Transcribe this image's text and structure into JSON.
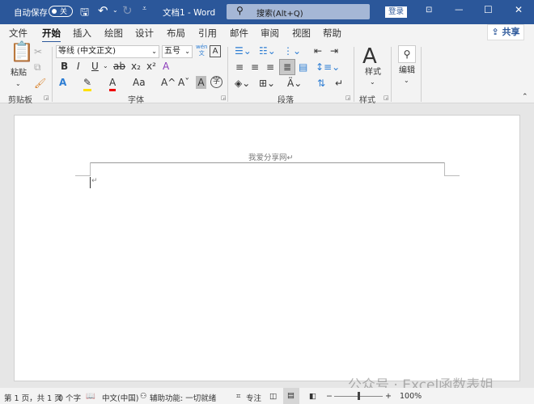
{
  "titlebar": {
    "autosave_label": "自动保存",
    "autosave_state": "关",
    "doc_title": "文档1 - Word",
    "search_placeholder": "搜索(Alt+Q)",
    "login": "登录",
    "bg_color": "#2b579a"
  },
  "tabs": [
    {
      "label": "文件"
    },
    {
      "label": "开始",
      "active": true
    },
    {
      "label": "插入"
    },
    {
      "label": "绘图"
    },
    {
      "label": "设计"
    },
    {
      "label": "布局"
    },
    {
      "label": "引用"
    },
    {
      "label": "邮件"
    },
    {
      "label": "审阅"
    },
    {
      "label": "视图"
    },
    {
      "label": "帮助"
    }
  ],
  "share_label": "共享",
  "ribbon": {
    "clipboard": {
      "paste": "粘贴",
      "group": "剪贴板"
    },
    "font": {
      "font_name": "等线 (中文正文)",
      "font_size": "五号",
      "group": "字体",
      "wen": "wén",
      "wen_char": "文",
      "bold": "B",
      "italic": "I",
      "underline": "U",
      "strike": "ab",
      "sub": "x₂",
      "sup": "x²",
      "clear": "A",
      "text_effect": "A",
      "highlight": "✎",
      "font_color": "A",
      "case": "Aa",
      "grow": "A^",
      "shrink": "Aˇ",
      "shade": "A",
      "circle": "字"
    },
    "paragraph": {
      "group": "段落"
    },
    "styles": {
      "label": "样式",
      "group": "样式"
    },
    "editing": {
      "label": "编辑"
    }
  },
  "document": {
    "header_text": "我爱分享网↵",
    "para_mark": "↵"
  },
  "status": {
    "page": "第 1 页，共 1 页",
    "words": "0 个字",
    "language": "中文(中国)",
    "accessibility": "辅助功能: 一切就绪",
    "focus": "专注",
    "zoom": "100%",
    "zoom_level": 1.0
  },
  "watermark": "公众号 · Excel函数表姐"
}
